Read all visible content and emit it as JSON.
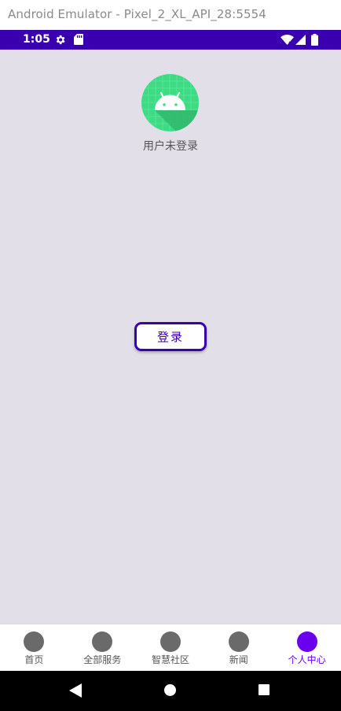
{
  "window": {
    "title": "Android Emulator - Pixel_2_XL_API_28:5554"
  },
  "status_bar": {
    "time": "1:05",
    "icons": [
      "gear-icon",
      "sd-card-icon",
      "wifi-icon",
      "cell-signal-icon",
      "battery-icon"
    ],
    "background": "#3a00b0"
  },
  "profile": {
    "avatar_icon": "android-logo-icon",
    "status_text": "用户未登录",
    "login_button": "登录"
  },
  "bottom_nav": {
    "items": [
      {
        "label": "首页",
        "active": false
      },
      {
        "label": "全部服务",
        "active": false
      },
      {
        "label": "智慧社区",
        "active": false
      },
      {
        "label": "新闻",
        "active": false
      },
      {
        "label": "个人中心",
        "active": true
      }
    ],
    "active_color": "#6a00ee",
    "inactive_color": "#6a6a6a"
  },
  "system_nav": {
    "buttons": [
      "back-icon",
      "home-icon",
      "recents-icon"
    ]
  },
  "colors": {
    "content_background": "#e2dfe9",
    "accent": "#3a00b0"
  }
}
